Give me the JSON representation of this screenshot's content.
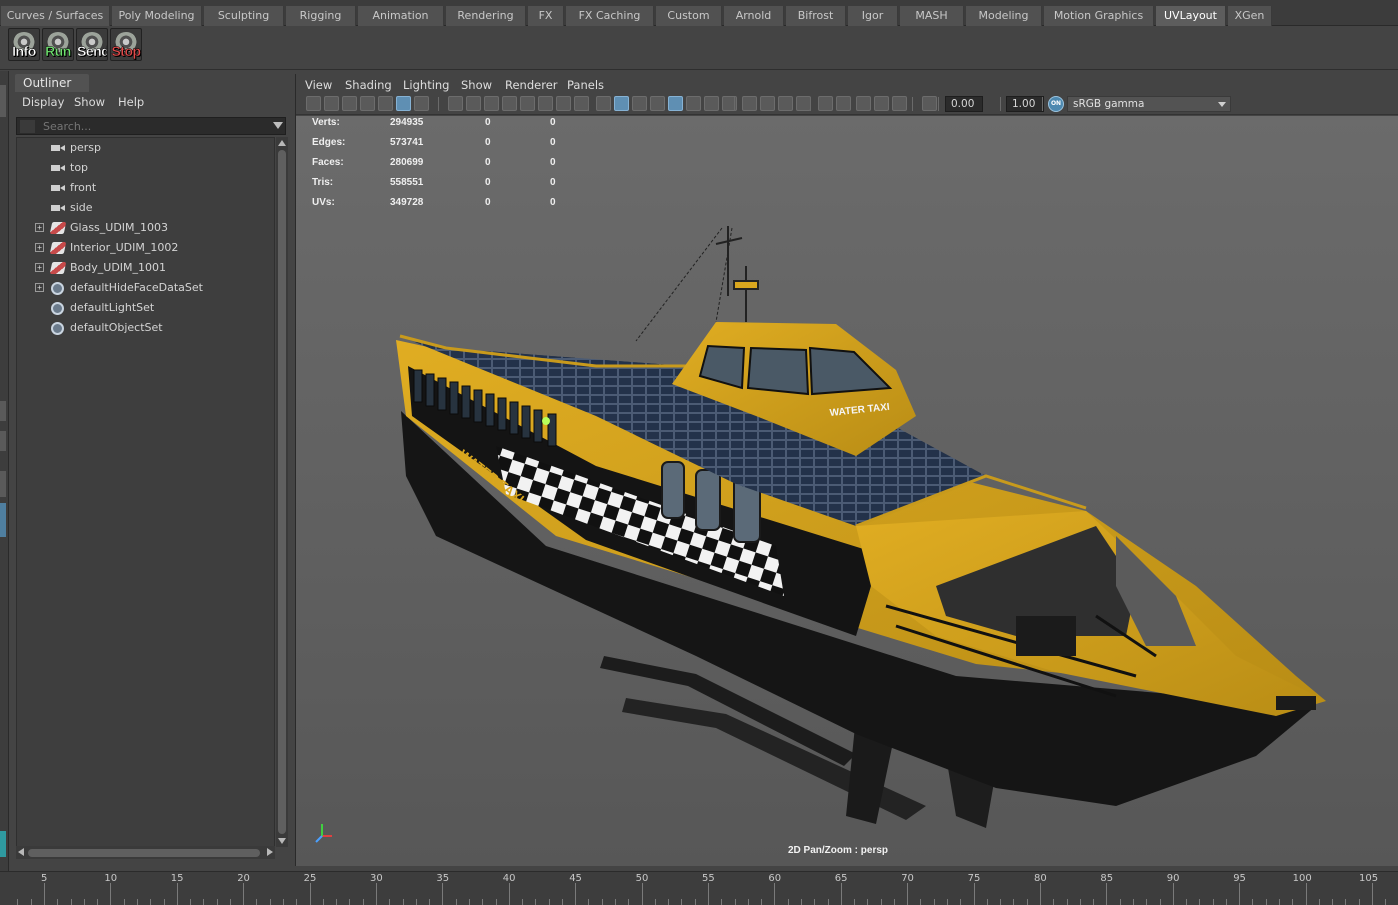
{
  "shelf_tabs": [
    {
      "label": "Curves / Surfaces",
      "active": false
    },
    {
      "label": "Poly Modeling",
      "active": false
    },
    {
      "label": "Sculpting",
      "active": false
    },
    {
      "label": "Rigging",
      "active": false
    },
    {
      "label": "Animation",
      "active": false
    },
    {
      "label": "Rendering",
      "active": false
    },
    {
      "label": "FX",
      "active": false
    },
    {
      "label": "FX Caching",
      "active": false
    },
    {
      "label": "Custom",
      "active": false
    },
    {
      "label": "Arnold",
      "active": false
    },
    {
      "label": "Bifrost",
      "active": false
    },
    {
      "label": "Igor",
      "active": false
    },
    {
      "label": "MASH",
      "active": false
    },
    {
      "label": "Modeling",
      "active": false
    },
    {
      "label": "Motion Graphics",
      "active": false
    },
    {
      "label": "UVLayout",
      "active": true
    },
    {
      "label": "XGen",
      "active": false
    }
  ],
  "shelf_buttons": [
    {
      "label": "Info",
      "color": "#ffffff"
    },
    {
      "label": "Run",
      "color": "#6fe26f"
    },
    {
      "label": "Send",
      "color": "#ffffff"
    },
    {
      "label": "Stop",
      "color": "#e24b4b"
    }
  ],
  "outliner": {
    "tab": "Outliner",
    "menu": [
      "Display",
      "Show",
      "Help"
    ],
    "search_placeholder": "Search...",
    "nodes": [
      {
        "label": "persp",
        "icon": "camera-icon",
        "expandable": false
      },
      {
        "label": "top",
        "icon": "camera-icon",
        "expandable": false
      },
      {
        "label": "front",
        "icon": "camera-icon",
        "expandable": false
      },
      {
        "label": "side",
        "icon": "camera-icon",
        "expandable": false
      },
      {
        "label": "Glass_UDIM_1003",
        "icon": "mesh-icon",
        "expandable": true
      },
      {
        "label": "Interior_UDIM_1002",
        "icon": "mesh-icon",
        "expandable": true
      },
      {
        "label": "Body_UDIM_1001",
        "icon": "mesh-icon",
        "expandable": true
      },
      {
        "label": "defaultHideFaceDataSet",
        "icon": "set-icon",
        "expandable": true
      },
      {
        "label": "defaultLightSet",
        "icon": "set-icon",
        "expandable": false
      },
      {
        "label": "defaultObjectSet",
        "icon": "set-icon",
        "expandable": false
      }
    ]
  },
  "viewport": {
    "menu": [
      "View",
      "Shading",
      "Lighting",
      "Show",
      "Renderer",
      "Panels"
    ],
    "exposure": "0.00",
    "gamma": "1.00",
    "color_management_toggle": "ON",
    "color_space": "sRGB gamma",
    "hud": [
      {
        "label": "Verts:",
        "values": [
          "294935",
          "0",
          "0"
        ]
      },
      {
        "label": "Edges:",
        "values": [
          "573741",
          "0",
          "0"
        ]
      },
      {
        "label": "Faces:",
        "values": [
          "280699",
          "0",
          "0"
        ]
      },
      {
        "label": "Tris:",
        "values": [
          "558551",
          "0",
          "0"
        ]
      },
      {
        "label": "UVs:",
        "values": [
          "349728",
          "0",
          "0"
        ]
      }
    ],
    "camera_label": "2D Pan/Zoom : persp",
    "boat_hull_name": "WATER TAXI",
    "boat_cabin_name": "WATER TAXI",
    "axis_colors": {
      "x": "#e04040",
      "y": "#40d040",
      "z": "#4aa0ff"
    },
    "boat_color": "#d9a61e"
  },
  "timeline": {
    "labels": [
      "5",
      "10",
      "15",
      "20",
      "25",
      "30",
      "35",
      "40",
      "45",
      "50",
      "55",
      "60",
      "65",
      "70",
      "75",
      "80",
      "85",
      "90",
      "95",
      "100",
      "105"
    ]
  }
}
